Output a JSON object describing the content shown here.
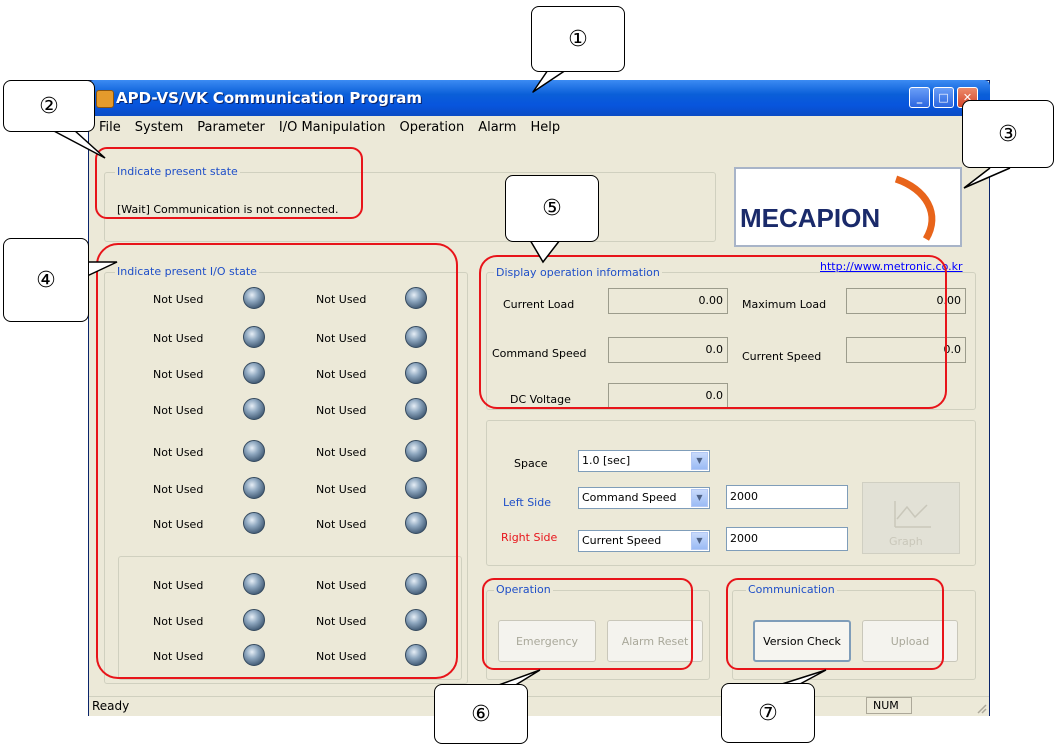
{
  "window": {
    "title": "APD-VS/VK Communication Program"
  },
  "menu": [
    "File",
    "System",
    "Parameter",
    "I/O Manipulation",
    "Operation",
    "Alarm",
    "Help"
  ],
  "present_state": {
    "title": "Indicate present state",
    "message": "[Wait] Communication is not connected."
  },
  "logo": {
    "text": "MECAPION",
    "url": "http://www.metronic.co.kr"
  },
  "io_state": {
    "title": "Indicate present I/O state",
    "rows": [
      [
        "Not Used",
        "Not Used"
      ],
      [
        "Not Used",
        "Not Used"
      ],
      [
        "Not Used",
        "Not Used"
      ],
      [
        "Not Used",
        "Not Used"
      ],
      [
        "Not Used",
        "Not Used"
      ],
      [
        "Not Used",
        "Not Used"
      ],
      [
        "Not Used",
        "Not Used"
      ],
      [
        "Not Used",
        "Not Used"
      ],
      [
        "Not Used",
        "Not Used"
      ],
      [
        "Not Used",
        "Not Used"
      ]
    ]
  },
  "operation_info": {
    "title": "Display operation information",
    "current_load_label": "Current Load",
    "current_load": "0.00",
    "max_load_label": "Maximum Load",
    "max_load": "0.00",
    "command_speed_label": "Command Speed",
    "command_speed": "0.0",
    "current_speed_label": "Current Speed",
    "current_speed": "0.0",
    "dc_voltage_label": "DC Voltage",
    "dc_voltage": "0.0"
  },
  "graph": {
    "space_label": "Space",
    "space_value": "1.0 [sec]",
    "left_label": "Left Side",
    "left_value": "Command Speed",
    "left_input": "2000",
    "right_label": "Right Side",
    "right_value": "Current Speed",
    "right_input": "2000",
    "graph_button": "Graph"
  },
  "operation": {
    "title": "Operation",
    "emergency": "Emergency",
    "alarm_reset": "Alarm Reset"
  },
  "communication": {
    "title": "Communication",
    "version_check": "Version Check",
    "upload": "Upload"
  },
  "statusbar": {
    "text": "Ready",
    "num": "NUM"
  },
  "callouts": [
    "①",
    "②",
    "③",
    "④",
    "⑤",
    "⑥",
    "⑦"
  ],
  "colors": {
    "title_blue": "#0a5fd8",
    "group_title": "#1f4fc8",
    "highlight_red": "#e8141a",
    "left_side": "#1f4fc8",
    "right_side": "#e8141a"
  }
}
